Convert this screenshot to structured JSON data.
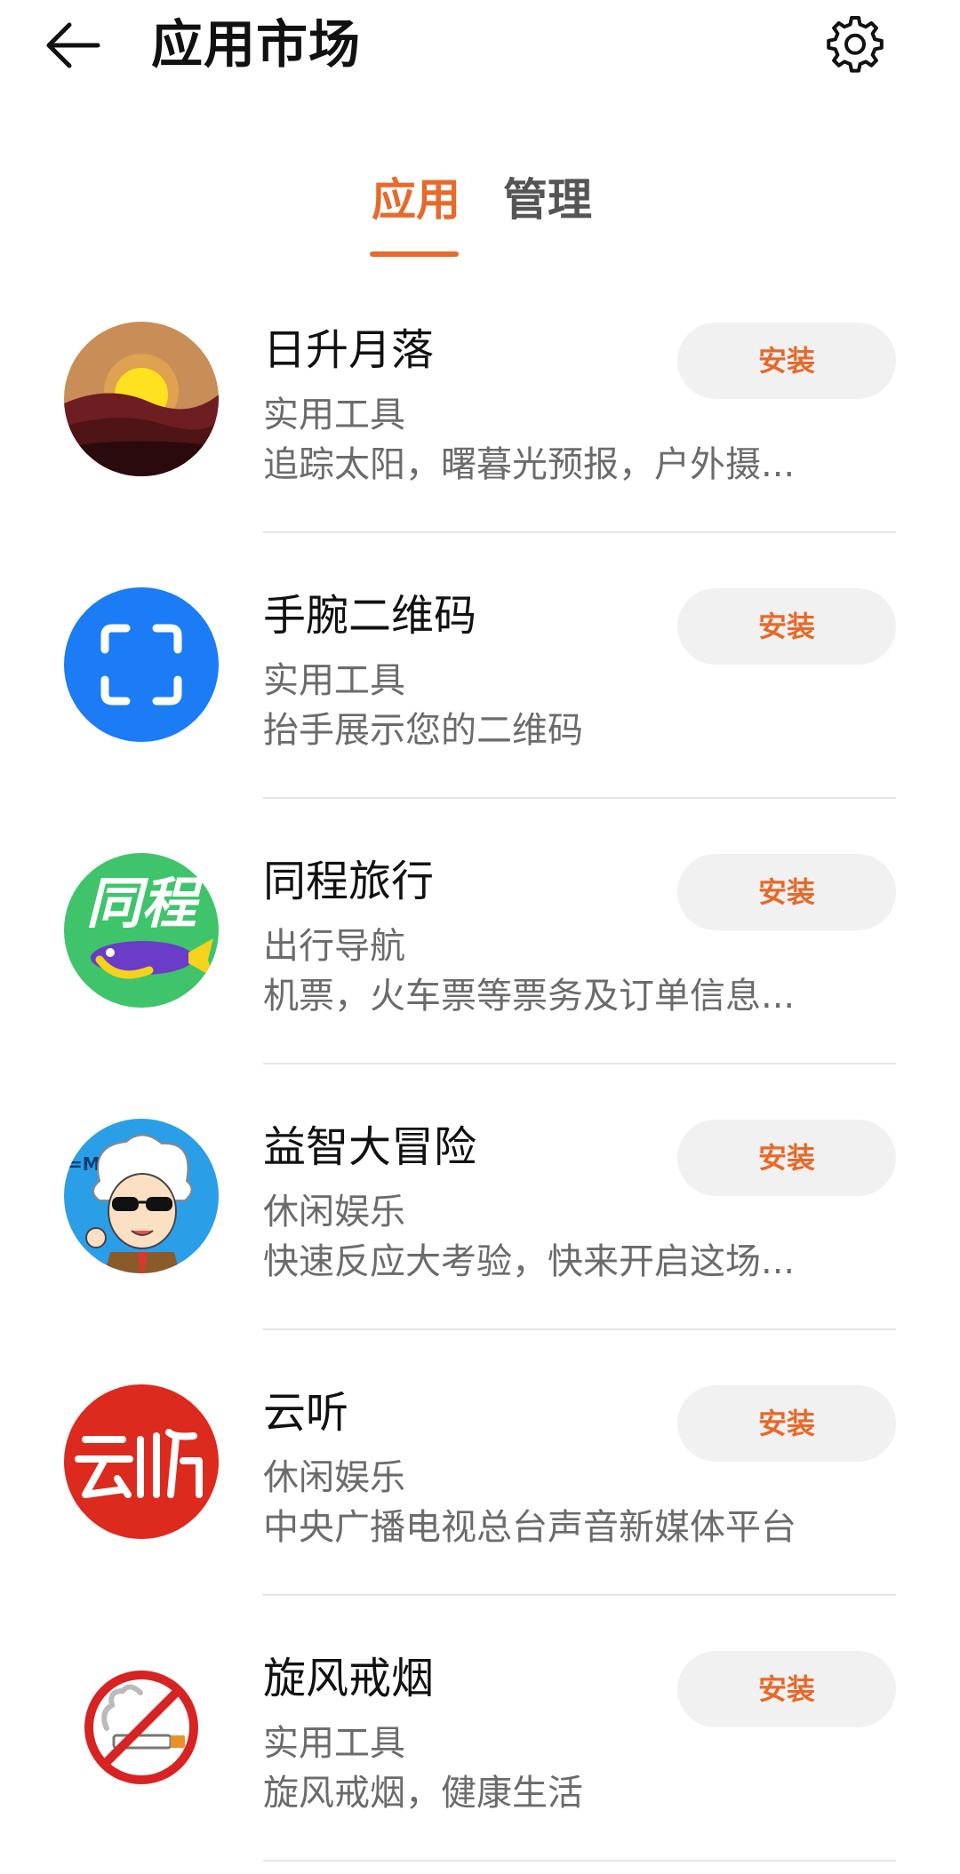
{
  "header": {
    "title": "应用市场",
    "back_icon": "arrow-left-icon",
    "settings_icon": "gear-icon"
  },
  "tabs": [
    {
      "label": "应用",
      "active": true
    },
    {
      "label": "管理",
      "active": false
    }
  ],
  "accent_color": "#e8692a",
  "apps": [
    {
      "name": "日升月落",
      "category": "实用工具",
      "description": "追踪太阳，曙暮光预报，户外摄...",
      "button": "安装",
      "icon": "sunset-icon"
    },
    {
      "name": "手腕二维码",
      "category": "实用工具",
      "description": "抬手展示您的二维码",
      "button": "安装",
      "icon": "qr-scan-icon"
    },
    {
      "name": "同程旅行",
      "category": "出行导航",
      "description": "机票，火车票等票务及订单信息...",
      "button": "安装",
      "icon": "tongcheng-logo",
      "icon_text": "同程"
    },
    {
      "name": "益智大冒险",
      "category": "休闲娱乐",
      "description": "快速反应大考验，快来开启这场...",
      "button": "安装",
      "icon": "einstein-cartoon-icon",
      "icon_text": "=MC"
    },
    {
      "name": "云听",
      "category": "休闲娱乐",
      "description": "中央广播电视总台声音新媒体平台",
      "button": "安装",
      "icon": "yunting-logo"
    },
    {
      "name": "旋风戒烟",
      "category": "实用工具",
      "description": "旋风戒烟，健康生活",
      "button": "安装",
      "icon": "no-smoking-icon"
    }
  ]
}
